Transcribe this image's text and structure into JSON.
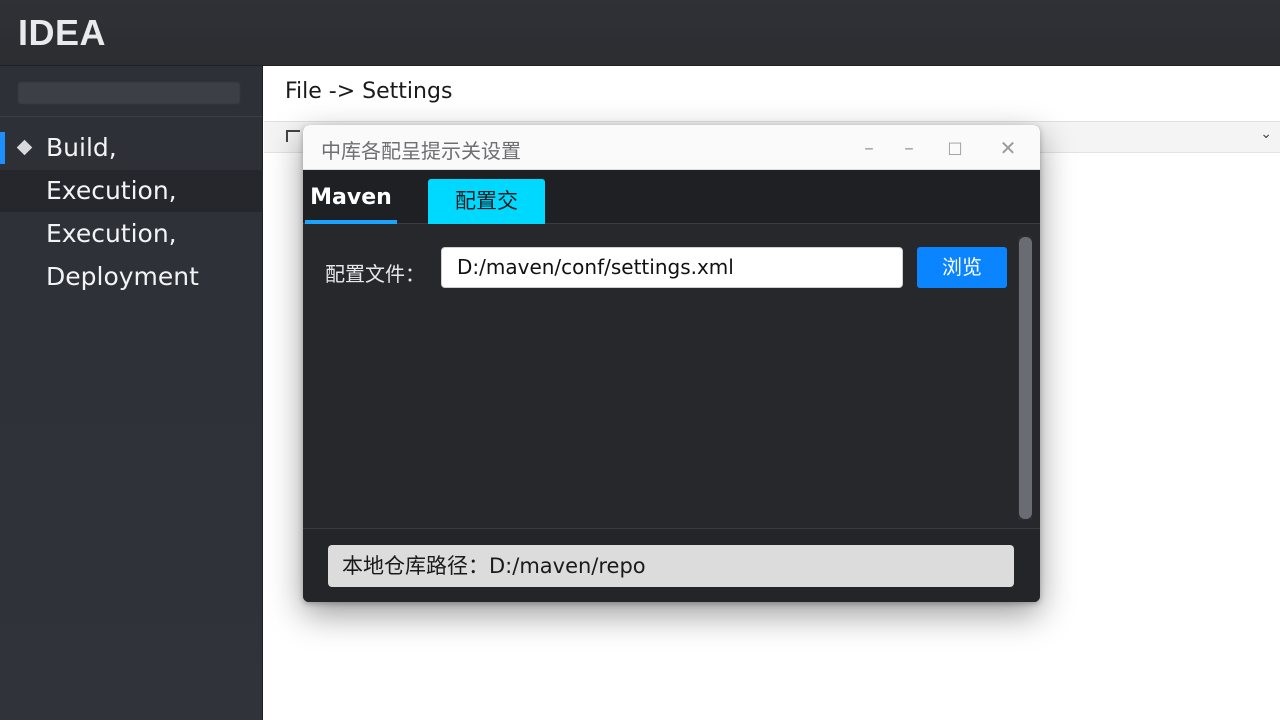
{
  "app": {
    "logo": "IDEA"
  },
  "sidebar": {
    "items": [
      {
        "label": "Build,"
      },
      {
        "label": "Execution,"
      },
      {
        "label": "Execution,"
      },
      {
        "label": "Deployment"
      }
    ]
  },
  "main": {
    "breadcrumb": "File -> Settings"
  },
  "dialog": {
    "title": "中库各配呈提示关设置",
    "window_controls": {
      "minimize_1": "–",
      "minimize_2": "–",
      "maximize": "□",
      "close": "✕"
    },
    "tabs": [
      {
        "label": "Maven"
      },
      {
        "label": "配置交"
      }
    ],
    "settings_file": {
      "label": "配置文件：",
      "value": "D:/maven/conf/settings.xml",
      "browse_label": "浏览"
    },
    "status": "本地仓库路径：D:/maven/repo"
  },
  "colors": {
    "accent_blue": "#1e8fff",
    "tab_active_underline": "#1aa3ff",
    "tab_highlight": "#00d9ff",
    "browse_button": "#0a84ff",
    "dialog_bg": "#27282c"
  }
}
